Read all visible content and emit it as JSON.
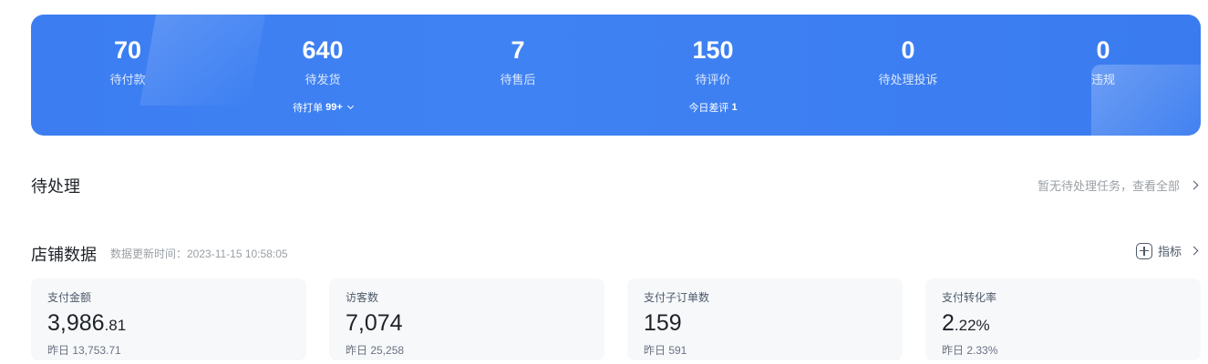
{
  "banner": {
    "stats": [
      {
        "value": "70",
        "label": "待付款"
      },
      {
        "value": "640",
        "label": "待发货",
        "sub_label": "待打单",
        "sub_value": "99+"
      },
      {
        "value": "7",
        "label": "待售后"
      },
      {
        "value": "150",
        "label": "待评价",
        "sub_label": "今日差评",
        "sub_value": "1"
      },
      {
        "value": "0",
        "label": "待处理投诉"
      },
      {
        "value": "0",
        "label": "违规"
      }
    ]
  },
  "pending": {
    "title": "待处理",
    "link": "暂无待处理任务，查看全部"
  },
  "store": {
    "title": "店铺数据",
    "update_time": "数据更新时间：2023-11-15 10:58:05",
    "metric_label": "指标",
    "cards": [
      {
        "label": "支付金额",
        "value_main": "3,986",
        "value_small": ".81",
        "prev": "昨日 13,753.71"
      },
      {
        "label": "访客数",
        "value_main": "7,074",
        "value_small": "",
        "prev": "昨日 25,258"
      },
      {
        "label": "支付子订单数",
        "value_main": "159",
        "value_small": "",
        "prev": "昨日 591"
      },
      {
        "label": "支付转化率",
        "value_main": "2",
        "value_small": ".22%",
        "prev": "昨日 2.33%"
      }
    ]
  },
  "colors": {
    "banner_blue": "#3c7ef2",
    "card_bg": "#f6f8fa"
  }
}
